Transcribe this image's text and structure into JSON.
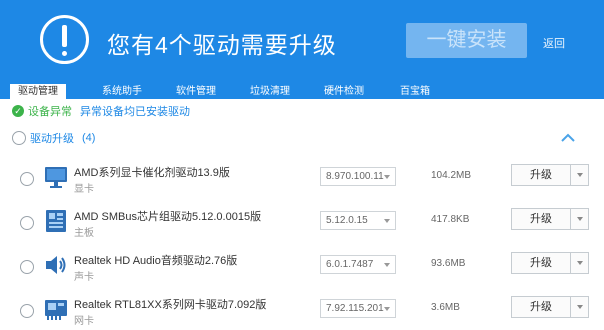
{
  "header": {
    "title": "您有4个驱动需要升级",
    "install_button": "一键安装",
    "back_link": "返回"
  },
  "tabs": [
    {
      "label": "驱动管理",
      "active": true
    },
    {
      "label": "系统助手",
      "active": false
    },
    {
      "label": "软件管理",
      "active": false
    },
    {
      "label": "垃圾清理",
      "active": false
    },
    {
      "label": "硬件检测",
      "active": false
    },
    {
      "label": "百宝箱",
      "active": false
    }
  ],
  "status": {
    "label": "设备异常",
    "message": "异常设备均已安装驱动"
  },
  "group": {
    "label": "驱动升级",
    "count": "(4)"
  },
  "drivers": [
    {
      "name": "AMD系列显卡催化剂驱动13.9版",
      "type": "显卡",
      "icon": "monitor-icon",
      "version": "8.970.100.11",
      "size": "104.2MB",
      "action": "升级"
    },
    {
      "name": "AMD SMBus芯片组驱动5.12.0.0015版",
      "type": "主板",
      "icon": "motherboard-icon",
      "version": "5.12.0.15",
      "size": "417.8KB",
      "action": "升级"
    },
    {
      "name": "Realtek HD Audio音频驱动2.76版",
      "type": "声卡",
      "icon": "speaker-icon",
      "version": "6.0.1.7487",
      "size": "93.6MB",
      "action": "升级"
    },
    {
      "name": "Realtek RTL81XX系列网卡驱动7.092版",
      "type": "网卡",
      "icon": "network-card-icon",
      "version": "7.92.115.201",
      "size": "3.6MB",
      "action": "升级"
    }
  ],
  "colors": {
    "header_blue": "#1e88e5",
    "status_green": "#3cb34a"
  }
}
